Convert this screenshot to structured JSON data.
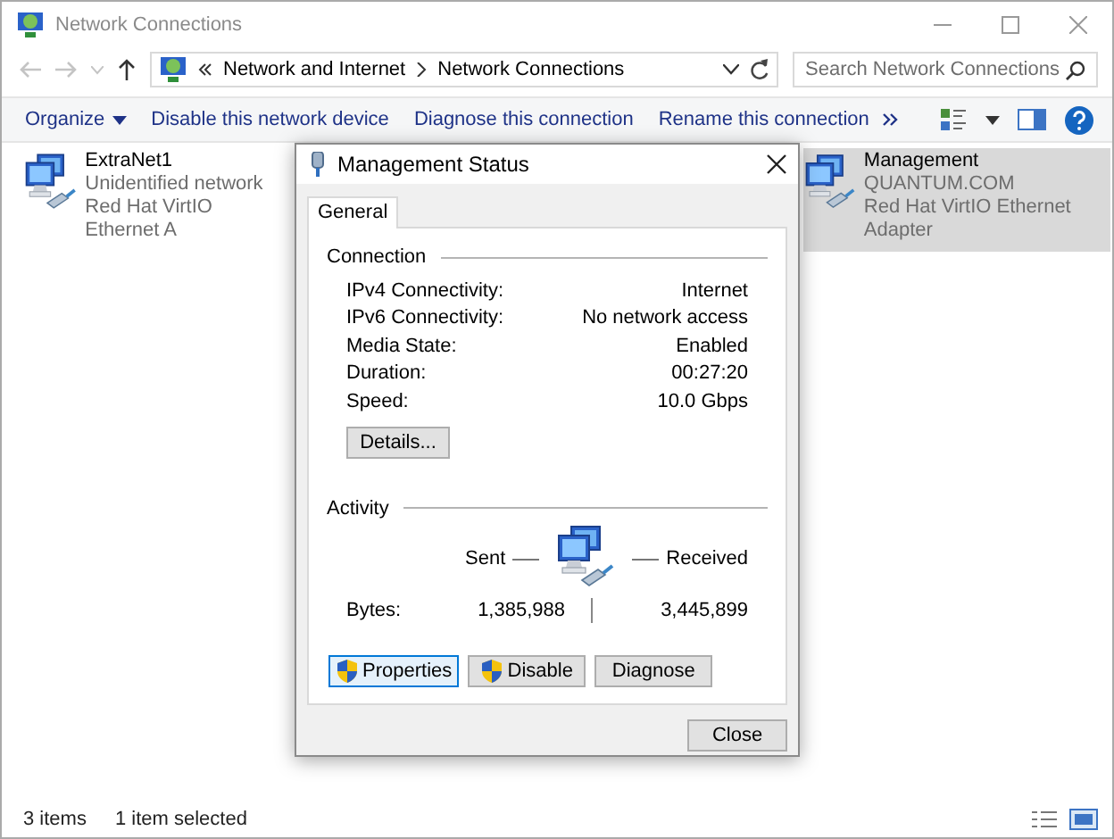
{
  "window": {
    "title": "Network Connections"
  },
  "address": {
    "crumbs": [
      "Network and Internet",
      "Network Connections"
    ]
  },
  "search": {
    "placeholder": "Search Network Connections"
  },
  "toolbar": [
    {
      "label": "Organize",
      "kind": "menu"
    },
    {
      "label": "Disable this network device",
      "kind": "command"
    },
    {
      "label": "Diagnose this connection",
      "kind": "command"
    },
    {
      "label": "Rename this connection",
      "kind": "command"
    }
  ],
  "connections": [
    {
      "name": "ExtraNet1",
      "status": "Unidentified network",
      "adapter": "Red Hat VirtIO Ethernet A",
      "selected": false
    },
    {
      "name": "Management",
      "status": "QUANTUM.COM",
      "adapter": "Red Hat VirtIO Ethernet Adapter",
      "selected": true
    }
  ],
  "status_bar": {
    "count": "3 items",
    "selection": "1 item selected"
  },
  "dialog": {
    "title": "Management Status",
    "tabs": [
      {
        "label": "General",
        "selected": true
      }
    ],
    "connection": {
      "heading": "Connection",
      "rows": [
        {
          "label": "IPv4 Connectivity:",
          "value": "Internet"
        },
        {
          "label": "IPv6 Connectivity:",
          "value": "No network access"
        },
        {
          "label": "Media State:",
          "value": "Enabled"
        },
        {
          "label": "Duration:",
          "value": "00:27:20"
        },
        {
          "label": "Speed:",
          "value": "10.0 Gbps"
        }
      ],
      "details_button": "Details..."
    },
    "activity": {
      "heading": "Activity",
      "sent_label": "Sent",
      "received_label": "Received",
      "bytes_label": "Bytes:",
      "sent": "1,385,988",
      "received": "3,445,899"
    },
    "buttons": [
      {
        "label": "Properties",
        "shield": true
      },
      {
        "label": "Disable",
        "shield": true
      },
      {
        "label": "Diagnose",
        "shield": false
      }
    ],
    "close_button": "Close"
  }
}
